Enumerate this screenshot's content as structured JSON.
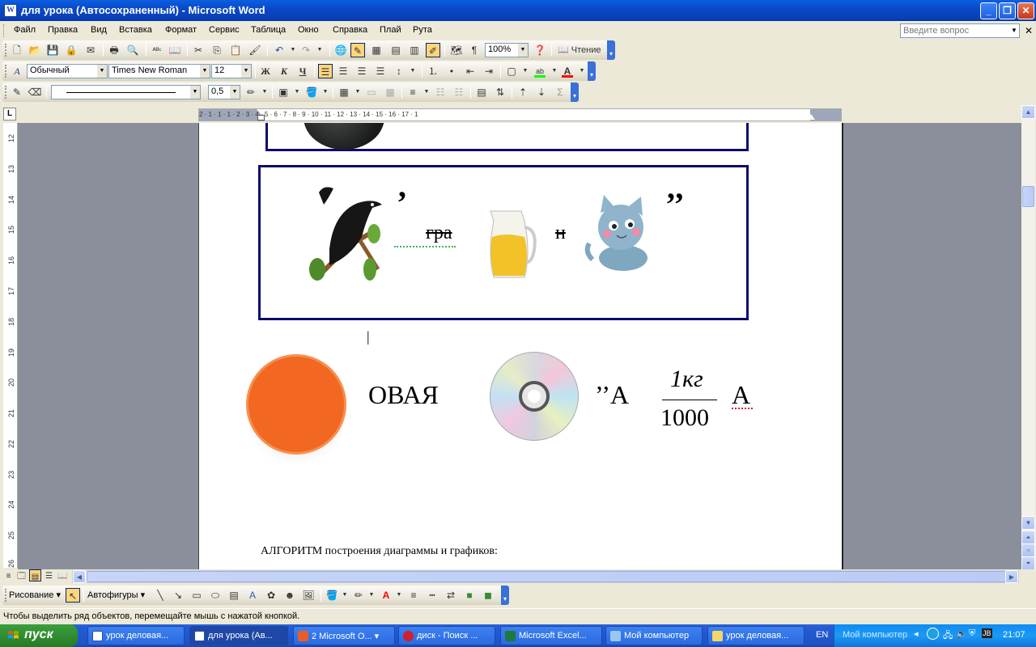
{
  "window": {
    "title": "для урока (Автосохраненный) - Microsoft Word",
    "icon": "word-doc-icon"
  },
  "menu": {
    "items": [
      "Файл",
      "Правка",
      "Вид",
      "Вставка",
      "Формат",
      "Сервис",
      "Таблица",
      "Окно",
      "Справка",
      "Плай",
      "Рута"
    ],
    "help_placeholder": "Введите вопрос"
  },
  "toolbar_standard": {
    "zoom": "100%",
    "reading_label": "Чтение"
  },
  "toolbar_formatting": {
    "style": "Обычный",
    "font": "Times New Roman",
    "size": "12",
    "bold": "Ж",
    "italic": "К",
    "underline": "Ч",
    "highlight_color": "#00ff00",
    "font_color": "#ff0000"
  },
  "toolbar_tables": {
    "line_weight": "0,5",
    "sum_symbol": "Σ"
  },
  "ruler": {
    "h_ticks": "2 · 1 · 1 · 1 · 2 · 3 · 4 · 5 · 6 · 7 · 8 · 9 · 10 · 11 · 12 · 13 · 14 · 15 · 16 · 17 · 1",
    "v_ticks": [
      "12",
      "13",
      "14",
      "15",
      "16",
      "17",
      "18",
      "19",
      "20",
      "21",
      "22",
      "23",
      "24",
      "25",
      "26"
    ],
    "corner": "L"
  },
  "document": {
    "rebus": {
      "comma_open": "’",
      "strike_syllable": "гра",
      "letter_n": "н",
      "comma_close": "’’"
    },
    "rebus2": {
      "word": "ОВАЯ",
      "quote_a": "’’А",
      "fraction_num": "1кг",
      "fraction_den": "1000",
      "letter_a": "А"
    },
    "heading": "АЛГОРИТМ построения диаграммы и графиков:",
    "cursor": "|"
  },
  "drawing_toolbar": {
    "draw_label": "Рисование",
    "autoshapes_label": "Автофигуры"
  },
  "status": {
    "text": "Чтобы выделить ряд объектов, перемещайте мышь с нажатой кнопкой."
  },
  "taskbar": {
    "start": "пуск",
    "tasks": [
      {
        "label": "урок деловая...",
        "icon": "word-icon"
      },
      {
        "label": "для урока (Ав...",
        "icon": "word-icon",
        "active": true
      },
      {
        "label": "2 Microsoft O...",
        "icon": "office-icon"
      },
      {
        "label": "диск - Поиск ...",
        "icon": "opera-icon"
      },
      {
        "label": "Microsoft Excel...",
        "icon": "excel-icon"
      },
      {
        "label": "Мой компьютер",
        "icon": "computer-icon"
      },
      {
        "label": "урок деловая...",
        "icon": "folder-icon"
      }
    ],
    "lang": "EN",
    "tray_label": "Мой компьютер",
    "clock": "21:07"
  }
}
